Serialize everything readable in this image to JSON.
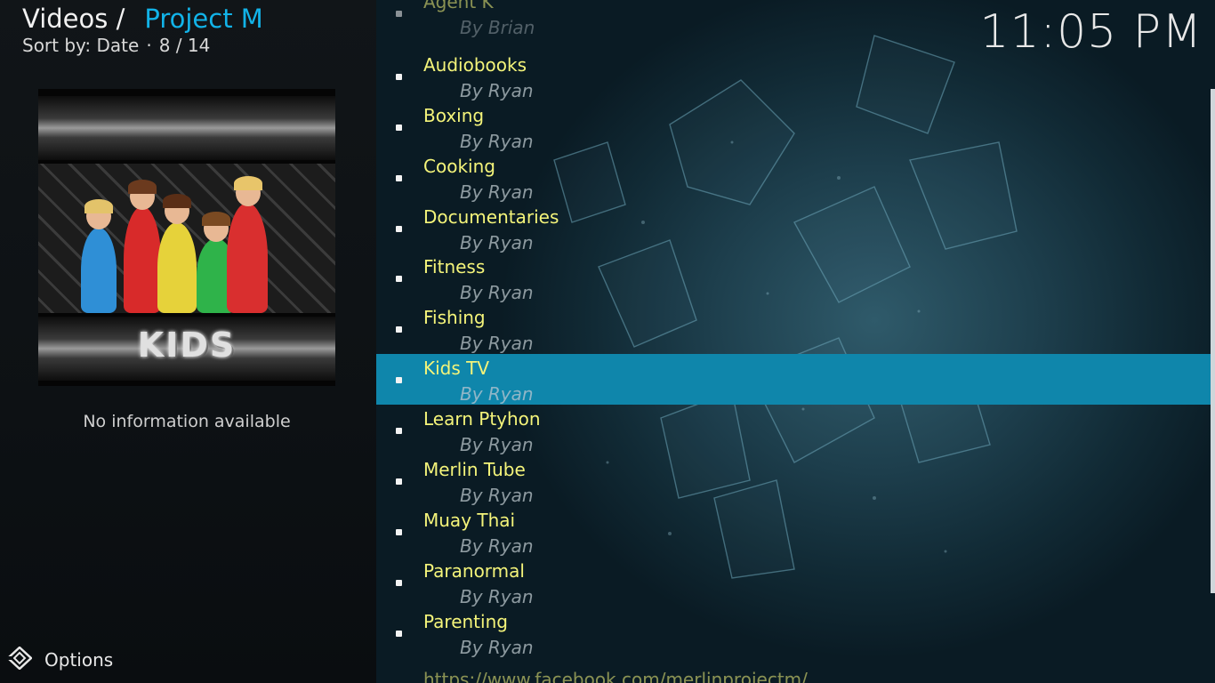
{
  "header": {
    "section": "Videos /",
    "project": "Project M",
    "sort_label": "Sort by: Date",
    "separator": "·",
    "position": "8 / 14"
  },
  "clock": "11:05 PM",
  "preview": {
    "logo_text": "KIDS",
    "info": "No information available"
  },
  "footer": {
    "options_label": "Options",
    "options_icon": "options-icon"
  },
  "list": {
    "items": [
      {
        "title": "Agent K",
        "author": "By Brian"
      },
      {
        "title": "Audiobooks",
        "author": "By Ryan"
      },
      {
        "title": "Boxing",
        "author": "By Ryan"
      },
      {
        "title": "Cooking",
        "author": "By Ryan"
      },
      {
        "title": "Documentaries",
        "author": "By Ryan"
      },
      {
        "title": "Fitness",
        "author": "By Ryan"
      },
      {
        "title": "Fishing",
        "author": "By Ryan"
      },
      {
        "title": "Kids TV",
        "author": "By Ryan"
      },
      {
        "title": "Learn Ptyhon",
        "author": "By Ryan"
      },
      {
        "title": "Merlin Tube",
        "author": "By Ryan"
      },
      {
        "title": "Muay Thai",
        "author": "By Ryan"
      },
      {
        "title": "Paranormal",
        "author": "By Ryan"
      },
      {
        "title": "Parenting",
        "author": "By Ryan"
      },
      {
        "title": "https://www.facebook.com/merlinprojectm/",
        "author": ""
      }
    ],
    "selected_index": 7
  },
  "colors": {
    "accent": "#12b3e8",
    "selection": "#0f86ab",
    "item_title": "#f4f47a"
  }
}
